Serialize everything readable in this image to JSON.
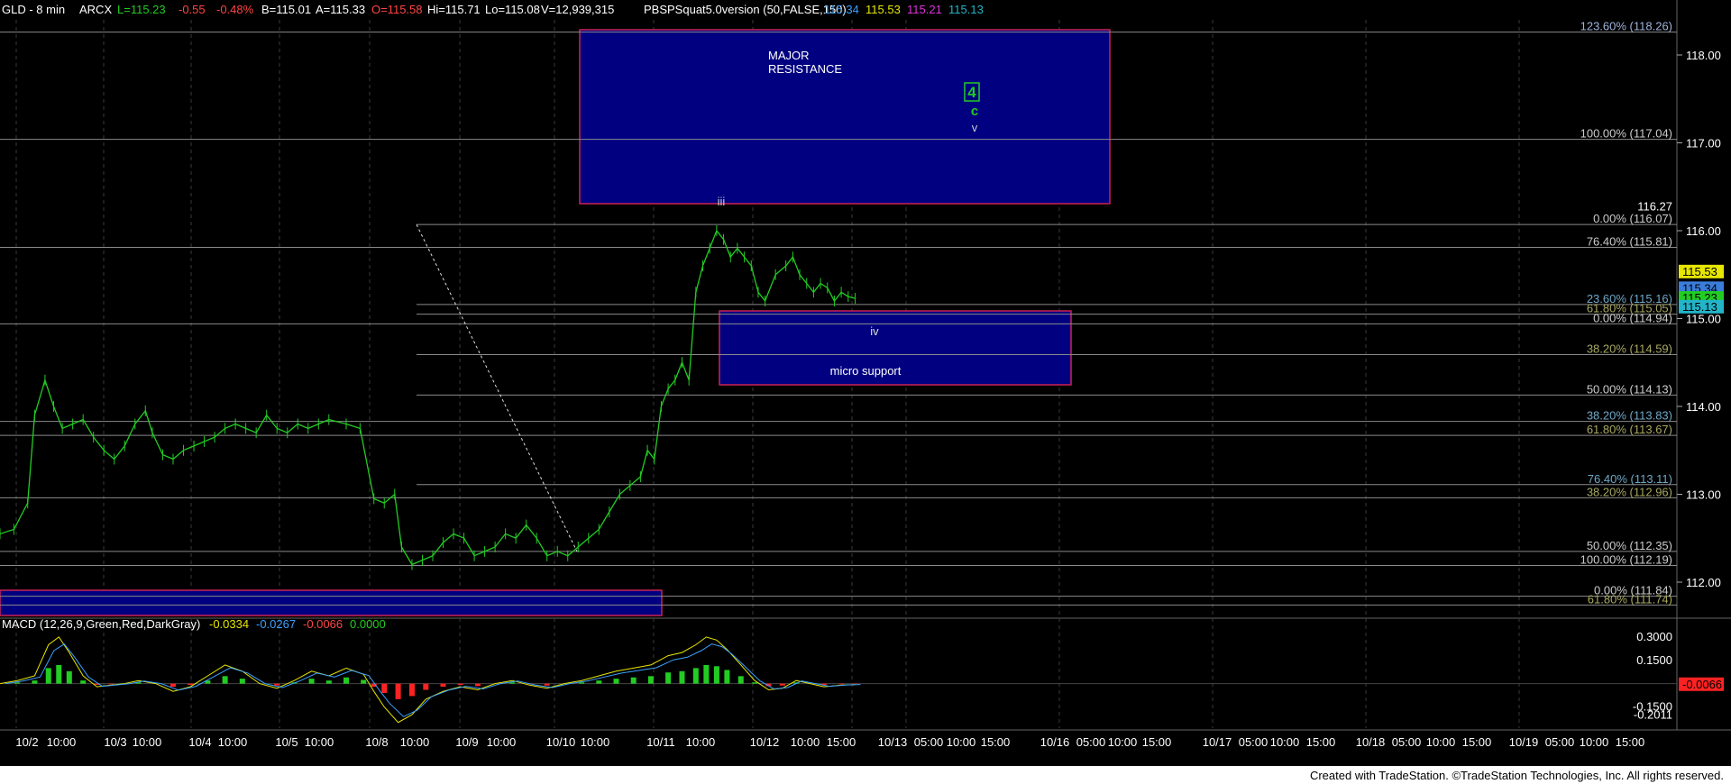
{
  "header": {
    "symbol": "GLD - 8 min",
    "exchange": "ARCX",
    "last": "L=115.23",
    "change": "-0.55",
    "change_pct": "-0.48%",
    "bid": "B=115.01",
    "ask": "A=115.33",
    "open": "O=115.58",
    "high": "Hi=115.71",
    "low": "Lo=115.08",
    "volume": "V=12,939,315",
    "indicator": "PBSPSquat5.0version (50,FALSE,150)",
    "ind_values": [
      "115.34",
      "115.53",
      "115.21",
      "115.13"
    ]
  },
  "macd": {
    "label": "MACD (12,26,9,Green,Red,DarkGray)",
    "values": [
      "-0.0334",
      "-0.0267",
      "-0.0066",
      "0.0000"
    ],
    "axis": [
      "0.3000",
      "0.1500",
      "-0.1500",
      "-0.2011"
    ],
    "current": "-0.0066"
  },
  "annotations": {
    "major_resistance": [
      "MAJOR",
      "RESISTANCE"
    ],
    "wave4": "4",
    "wave_c": "c",
    "wave_v": "v",
    "wave_iii": "iii",
    "wave_iv": "iv",
    "micro_support": "micro support"
  },
  "footer": "Created with TradeStation. ©TradeStation Technologies, Inc. All rights reserved.",
  "colors": {
    "price": "#22cc22",
    "box_fill": "#000080",
    "box_border": "#cc2255",
    "fib_line": "#8a8a8a",
    "axis_text": "#ffffff"
  },
  "chart_data": {
    "type": "line",
    "title": "GLD - 8 min",
    "ylim": [
      111.6,
      118.4
    ],
    "y_ticks": [
      112.0,
      113.0,
      114.0,
      115.0,
      116.0,
      117.0,
      118.0
    ],
    "x_labels": [
      "10/2",
      "10:00",
      "10/3",
      "10:00",
      "10/4",
      "10:00",
      "10/5",
      "10:00",
      "10/8",
      "10:00",
      "10/9",
      "10:00",
      "10/10",
      "10:00",
      "10/11",
      "10:00",
      "10/12",
      "10:00",
      "15:00",
      "10/13",
      "05:00",
      "10:00",
      "15:00",
      "10/16",
      "05:00",
      "10:00",
      "15:00",
      "10/17",
      "05:00",
      "10:00",
      "15:00",
      "10/18",
      "05:00",
      "10:00",
      "15:00",
      "10/19",
      "05:00",
      "10:00",
      "15:00"
    ],
    "fib_levels": [
      {
        "label": "123.60% (118.26)",
        "value": 118.26,
        "color": "#9fb3d9"
      },
      {
        "label": "100.00% (117.04)",
        "value": 117.04,
        "color": "#cccccc"
      },
      {
        "label": "0.00% (116.07)",
        "value": 116.07,
        "color": "#cccccc"
      },
      {
        "label": "76.40% (115.81)",
        "value": 115.81,
        "color": "#cccccc"
      },
      {
        "label": "23.60% (115.16)",
        "value": 115.16,
        "color": "#6fa8c8"
      },
      {
        "label": "61.80% (115.05)",
        "value": 115.05,
        "color": "#a8a860"
      },
      {
        "label": "0.00% (114.94)",
        "value": 114.94,
        "color": "#cccccc"
      },
      {
        "label": "38.20% (114.59)",
        "value": 114.59,
        "color": "#a8a860"
      },
      {
        "label": "50.00% (114.13)",
        "value": 114.13,
        "color": "#cccccc"
      },
      {
        "label": "38.20% (113.83)",
        "value": 113.83,
        "color": "#6fa8c8"
      },
      {
        "label": "61.80% (113.67)",
        "value": 113.67,
        "color": "#a8a860"
      },
      {
        "label": "76.40% (113.11)",
        "value": 113.11,
        "color": "#6fa8c8"
      },
      {
        "label": "38.20% (112.96)",
        "value": 112.96,
        "color": "#a8a860"
      },
      {
        "label": "50.00% (112.35)",
        "value": 112.35,
        "color": "#cccccc"
      },
      {
        "label": "100.00% (112.19)",
        "value": 112.19,
        "color": "#cccccc"
      },
      {
        "label": "0.00% (111.84)",
        "value": 111.84,
        "color": "#cccccc"
      },
      {
        "label": "61.80% (111.74)",
        "value": 111.74,
        "color": "#a8a860"
      }
    ],
    "price_marker": "116.27",
    "right_tags": [
      {
        "label": "115.53",
        "value": 115.53,
        "color": "#e6e600"
      },
      {
        "label": "115.34",
        "value": 115.34,
        "color": "#3a7ddb"
      },
      {
        "label": "115.23",
        "value": 115.23,
        "color": "#22cc22"
      },
      {
        "label": "115.13",
        "value": 115.13,
        "color": "#22b4c8"
      }
    ],
    "x_index_range": [
      0,
      500
    ],
    "price_series": [
      [
        0,
        112.55
      ],
      [
        8,
        112.6
      ],
      [
        16,
        112.9
      ],
      [
        20,
        113.9
      ],
      [
        26,
        114.3
      ],
      [
        31,
        114.0
      ],
      [
        36,
        113.75
      ],
      [
        42,
        113.8
      ],
      [
        48,
        113.85
      ],
      [
        54,
        113.65
      ],
      [
        60,
        113.5
      ],
      [
        66,
        113.4
      ],
      [
        72,
        113.55
      ],
      [
        78,
        113.8
      ],
      [
        84,
        113.95
      ],
      [
        88,
        113.7
      ],
      [
        94,
        113.45
      ],
      [
        100,
        113.4
      ],
      [
        106,
        113.5
      ],
      [
        112,
        113.55
      ],
      [
        118,
        113.6
      ],
      [
        124,
        113.65
      ],
      [
        130,
        113.75
      ],
      [
        136,
        113.8
      ],
      [
        142,
        113.75
      ],
      [
        148,
        113.7
      ],
      [
        154,
        113.9
      ],
      [
        160,
        113.75
      ],
      [
        166,
        113.7
      ],
      [
        172,
        113.8
      ],
      [
        178,
        113.75
      ],
      [
        184,
        113.8
      ],
      [
        190,
        113.85
      ],
      [
        200,
        113.8
      ],
      [
        208,
        113.75
      ],
      [
        216,
        112.95
      ],
      [
        222,
        112.9
      ],
      [
        228,
        113.0
      ],
      [
        232,
        112.4
      ],
      [
        238,
        112.2
      ],
      [
        244,
        112.25
      ],
      [
        250,
        112.3
      ],
      [
        256,
        112.45
      ],
      [
        262,
        112.55
      ],
      [
        268,
        112.5
      ],
      [
        274,
        112.3
      ],
      [
        280,
        112.35
      ],
      [
        286,
        112.4
      ],
      [
        292,
        112.55
      ],
      [
        298,
        112.5
      ],
      [
        304,
        112.65
      ],
      [
        310,
        112.5
      ],
      [
        316,
        112.3
      ],
      [
        322,
        112.35
      ],
      [
        328,
        112.3
      ],
      [
        334,
        112.4
      ],
      [
        340,
        112.5
      ],
      [
        346,
        112.6
      ],
      [
        352,
        112.8
      ],
      [
        358,
        113.0
      ],
      [
        364,
        113.1
      ],
      [
        370,
        113.2
      ],
      [
        374,
        113.5
      ],
      [
        378,
        113.4
      ],
      [
        382,
        114.0
      ],
      [
        386,
        114.2
      ],
      [
        390,
        114.3
      ],
      [
        394,
        114.5
      ],
      [
        398,
        114.3
      ],
      [
        402,
        115.3
      ],
      [
        406,
        115.6
      ],
      [
        410,
        115.8
      ],
      [
        414,
        116.0
      ],
      [
        418,
        115.9
      ],
      [
        422,
        115.7
      ],
      [
        426,
        115.8
      ],
      [
        430,
        115.7
      ],
      [
        434,
        115.6
      ],
      [
        438,
        115.3
      ],
      [
        442,
        115.2
      ],
      [
        448,
        115.5
      ],
      [
        454,
        115.6
      ],
      [
        458,
        115.7
      ],
      [
        462,
        115.5
      ],
      [
        466,
        115.4
      ],
      [
        470,
        115.3
      ],
      [
        474,
        115.4
      ],
      [
        478,
        115.35
      ],
      [
        482,
        115.2
      ],
      [
        486,
        115.3
      ],
      [
        490,
        115.25
      ],
      [
        494,
        115.23
      ]
    ],
    "macd_series": [
      [
        0,
        0.0
      ],
      [
        10,
        0.02
      ],
      [
        20,
        0.05
      ],
      [
        28,
        0.25
      ],
      [
        34,
        0.3
      ],
      [
        40,
        0.2
      ],
      [
        48,
        0.05
      ],
      [
        56,
        -0.02
      ],
      [
        64,
        -0.01
      ],
      [
        72,
        0.0
      ],
      [
        80,
        0.02
      ],
      [
        90,
        0.0
      ],
      [
        100,
        -0.05
      ],
      [
        110,
        -0.02
      ],
      [
        120,
        0.05
      ],
      [
        130,
        0.12
      ],
      [
        140,
        0.08
      ],
      [
        150,
        0.0
      ],
      [
        160,
        -0.03
      ],
      [
        170,
        0.02
      ],
      [
        180,
        0.08
      ],
      [
        190,
        0.05
      ],
      [
        200,
        0.1
      ],
      [
        210,
        0.06
      ],
      [
        216,
        -0.05
      ],
      [
        222,
        -0.15
      ],
      [
        230,
        -0.25
      ],
      [
        238,
        -0.2
      ],
      [
        246,
        -0.1
      ],
      [
        256,
        -0.05
      ],
      [
        266,
        -0.02
      ],
      [
        276,
        -0.04
      ],
      [
        286,
        0.0
      ],
      [
        296,
        0.02
      ],
      [
        306,
        -0.01
      ],
      [
        316,
        -0.03
      ],
      [
        326,
        0.0
      ],
      [
        336,
        0.02
      ],
      [
        346,
        0.05
      ],
      [
        356,
        0.08
      ],
      [
        366,
        0.1
      ],
      [
        376,
        0.12
      ],
      [
        386,
        0.18
      ],
      [
        394,
        0.2
      ],
      [
        402,
        0.25
      ],
      [
        408,
        0.3
      ],
      [
        414,
        0.28
      ],
      [
        420,
        0.22
      ],
      [
        428,
        0.12
      ],
      [
        436,
        0.02
      ],
      [
        444,
        -0.04
      ],
      [
        452,
        -0.03
      ],
      [
        460,
        0.02
      ],
      [
        468,
        0.0
      ],
      [
        476,
        -0.02
      ],
      [
        486,
        -0.01
      ],
      [
        494,
        -0.0066
      ]
    ],
    "macd_ylim": [
      -0.24,
      0.34
    ]
  }
}
